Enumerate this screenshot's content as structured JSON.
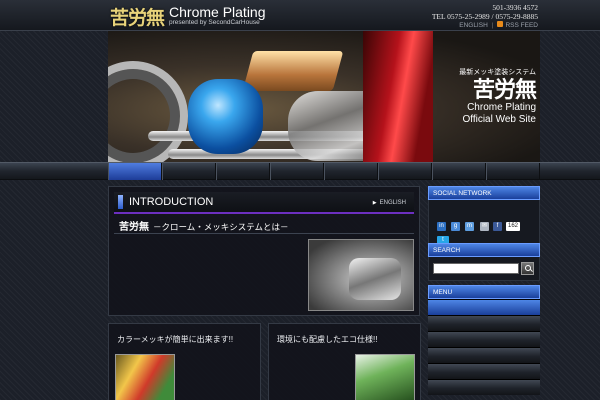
{
  "header": {
    "logo_kanji": "苦労無",
    "logo_title": "Chrome Plating",
    "logo_sub": "presented by SecondCarHouse",
    "contact_line1": "501-3936 4572",
    "contact_line2": "TEL 0575-25-2989 / 0575-29-8885",
    "link_english": "ENGLISH",
    "link_rss": "RSS FEED"
  },
  "hero": {
    "small": "最新メッキ塗装システム",
    "kanji": "苦労無",
    "line1": "Chrome Plating",
    "line2": "Official Web Site"
  },
  "intro": {
    "title": "INTRODUCTION",
    "lang_link": "ENGLISH",
    "subtitle_kanji": "苦労無",
    "subtitle": "－クローム・メッキシステムとは－"
  },
  "cards": [
    {
      "title": "カラーメッキが簡単に出来ます!!"
    },
    {
      "title": "環境にも配慮したエコ仕様!!"
    }
  ],
  "sidebar": {
    "social_title": "SOCIAL NETWORK",
    "fb_count": "162",
    "search_title": "SEARCH",
    "search_placeholder": "",
    "menu_title": "MENU"
  },
  "icons": {
    "linkedin": "in",
    "google": "g",
    "mixi": "m",
    "mail": "✉",
    "facebook": "f",
    "twitter": "t"
  },
  "colors": {
    "accent_blue": "#2c5ccc",
    "accent_purple": "#6c2fc0",
    "logo_gold": "#e7d27a"
  }
}
